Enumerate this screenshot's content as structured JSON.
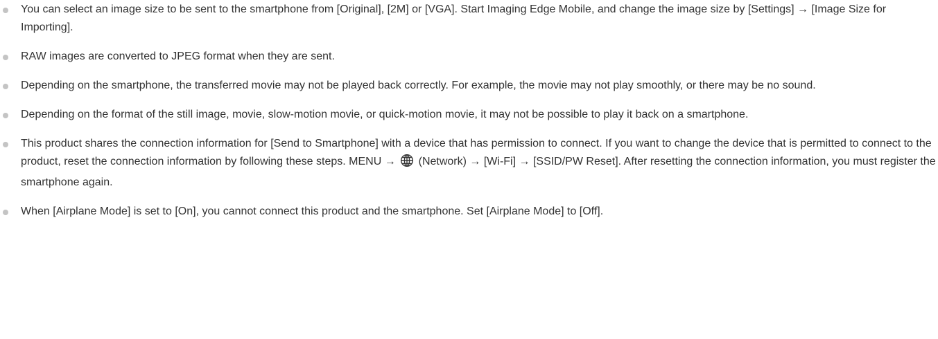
{
  "notes": [
    {
      "text": "You can select an image size to be sent to the smartphone from [Original], [2M] or [VGA]. Start Imaging Edge Mobile, and change the image size by [Settings] → [Image Size for Importing]."
    },
    {
      "text": "RAW images are converted to JPEG format when they are sent."
    },
    {
      "text": "Depending on the smartphone, the transferred movie may not be played back correctly. For example, the movie may not play smoothly, or there may be no sound."
    },
    {
      "text": "Depending on the format of the still image, movie, slow-motion movie, or quick-motion movie, it may not be possible to play it back on a smartphone."
    },
    {
      "text_before_icon": "This product shares the connection information for [Send to Smartphone] with a device that has permission to connect. If you want to change the device that is permitted to connect to the product, reset the connection information by following these steps. MENU →",
      "icon": "network-globe-icon",
      "text_after_icon": "(Network) → [Wi-Fi] → [SSID/PW Reset]. After resetting the connection information, you must register the smartphone again."
    },
    {
      "text": "When [Airplane Mode] is set to [On], you cannot connect this product and the smartphone. Set [Airplane Mode] to [Off]."
    }
  ],
  "colors": {
    "text": "#333333",
    "bullet": "#c4c4c4"
  }
}
